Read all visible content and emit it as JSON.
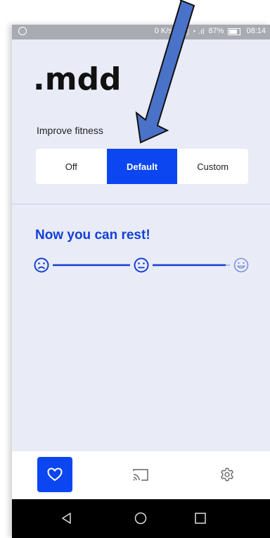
{
  "status_bar": {
    "network_speed": "0 K/s",
    "battery": "87%",
    "time": "08:14"
  },
  "app": {
    "logo": ".mdd"
  },
  "fitness": {
    "label": "Improve fitness",
    "options": [
      "Off",
      "Default",
      "Custom"
    ],
    "selected": "Default"
  },
  "rest": {
    "title": "Now you can rest!",
    "progress_icons": [
      "sad-face-icon",
      "neutral-face-icon",
      "happy-face-icon"
    ],
    "progress_fraction": 0.95
  },
  "bottom_nav": {
    "items": [
      "heart-icon",
      "cast-icon",
      "settings-gear-icon"
    ],
    "active": "heart-icon"
  },
  "system_nav": {
    "items": [
      "back-icon",
      "home-icon",
      "recents-icon"
    ]
  },
  "colors": {
    "accent": "#0b46f0",
    "title": "#1340d6",
    "background": "#e9ecf7",
    "annotation_arrow": "#4a72c8"
  }
}
